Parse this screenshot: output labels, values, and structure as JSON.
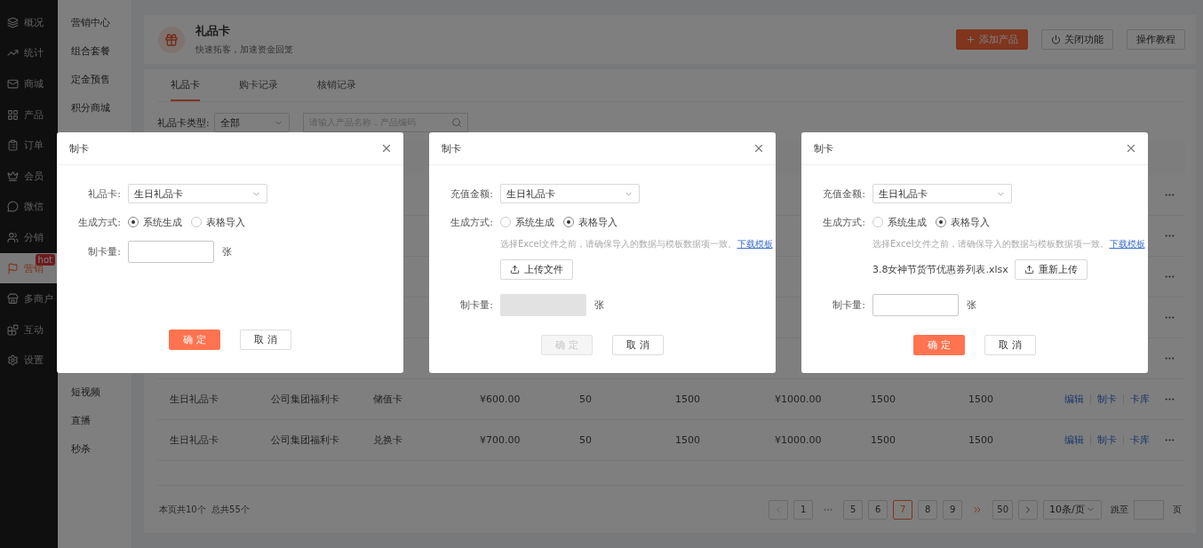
{
  "sidebar": {
    "items": [
      {
        "label": "概况",
        "selected": false
      },
      {
        "label": "统计",
        "selected": false
      },
      {
        "label": "商城",
        "selected": false
      },
      {
        "label": "产品",
        "selected": false
      },
      {
        "label": "订单",
        "selected": false
      },
      {
        "label": "会员",
        "selected": false
      },
      {
        "label": "微信",
        "selected": false
      },
      {
        "label": "分销",
        "selected": false
      },
      {
        "label": "营销",
        "selected": true,
        "badge": "hot"
      },
      {
        "label": "多商户",
        "selected": false
      },
      {
        "label": "互动",
        "selected": false
      },
      {
        "label": "设置",
        "selected": false
      }
    ]
  },
  "submenu": {
    "groups": [
      [
        "营销中心",
        "组合套餐",
        "定金预售",
        "积分商城"
      ],
      [
        "短视频",
        "直播",
        "秒杀"
      ]
    ]
  },
  "header": {
    "title": "礼品卡",
    "subtitle": "快速拓客，加速资金回笼",
    "buttons": [
      {
        "label": "添加产品",
        "kind": "primary"
      },
      {
        "label": "关闭功能",
        "kind": "power"
      },
      {
        "label": "操作教程",
        "kind": "default"
      }
    ]
  },
  "tabs": [
    {
      "label": "礼品卡",
      "selected": true
    },
    {
      "label": "购卡记录",
      "selected": false
    },
    {
      "label": "核销记录",
      "selected": false
    }
  ],
  "filter": {
    "label": "礼品卡类型:",
    "value": "全部",
    "search_placeholder": "请输入产品名称，产品编码"
  },
  "table": {
    "rows": [
      {
        "cells": [
          "生日礼品卡",
          "公司集团福利卡",
          "储值卡",
          "¥600.00",
          "50",
          "1500",
          "¥1000.00",
          "1500",
          "1500"
        ],
        "actions": [
          "编辑",
          "制卡",
          "卡库"
        ]
      },
      {
        "cells": [
          "生日礼品卡",
          "公司集团福利卡",
          "兑换卡",
          "¥700.00",
          "50",
          "1500",
          "¥1000.00",
          "1500",
          "1500"
        ],
        "actions": [
          "编辑",
          "制卡",
          "卡库"
        ]
      }
    ]
  },
  "pagination": {
    "summary": "本页共10个  总共55个",
    "pages": [
      {
        "label": "1",
        "selected": false
      },
      {
        "label": "5",
        "selected": false
      },
      {
        "label": "6",
        "selected": false
      },
      {
        "label": "7",
        "selected": true
      },
      {
        "label": "8",
        "selected": false
      },
      {
        "label": "9",
        "selected": false
      },
      {
        "label": "50",
        "selected": false
      }
    ],
    "page_size": "10条/页",
    "jump_label": "跳至",
    "jump_unit": "页"
  },
  "dialogs": [
    {
      "title": "制卡",
      "card": {
        "label": "礼品卡:",
        "value": "生日礼品卡"
      },
      "method": {
        "label": "生成方式:",
        "options": [
          {
            "label": "系统生成",
            "selected": true
          },
          {
            "label": "表格导入",
            "selected": false
          }
        ]
      },
      "quantity": {
        "label": "制卡量:",
        "unit": "张",
        "disabled": false
      },
      "confirm": {
        "label": "确 定",
        "disabled": false
      },
      "cancel": "取 消"
    },
    {
      "title": "制卡",
      "card": {
        "label": "充值金额:",
        "value": "生日礼品卡"
      },
      "method": {
        "label": "生成方式:",
        "options": [
          {
            "label": "系统生成",
            "selected": false
          },
          {
            "label": "表格导入",
            "selected": true
          }
        ],
        "hint": "选择Excel文件之前，请确保导入的数据与模板数据项一致。",
        "link": "下载模板",
        "upload_button": "上传文件"
      },
      "quantity": {
        "label": "制卡量:",
        "unit": "张",
        "disabled": true
      },
      "confirm": {
        "label": "确 定",
        "disabled": true
      },
      "cancel": "取 消"
    },
    {
      "title": "制卡",
      "card": {
        "label": "充值金额:",
        "value": "生日礼品卡"
      },
      "method": {
        "label": "生成方式:",
        "options": [
          {
            "label": "系统生成",
            "selected": false
          },
          {
            "label": "表格导入",
            "selected": true
          }
        ],
        "hint": "选择Excel文件之前，请确保导入的数据与模板数据项一致。",
        "link": "下载模板",
        "file": "3.8女神节货节优惠券列表.xlsx",
        "upload_button": "重新上传"
      },
      "quantity": {
        "label": "制卡量:",
        "unit": "张",
        "disabled": false
      },
      "confirm": {
        "label": "确 定",
        "disabled": false
      },
      "cancel": "取 消"
    }
  ]
}
